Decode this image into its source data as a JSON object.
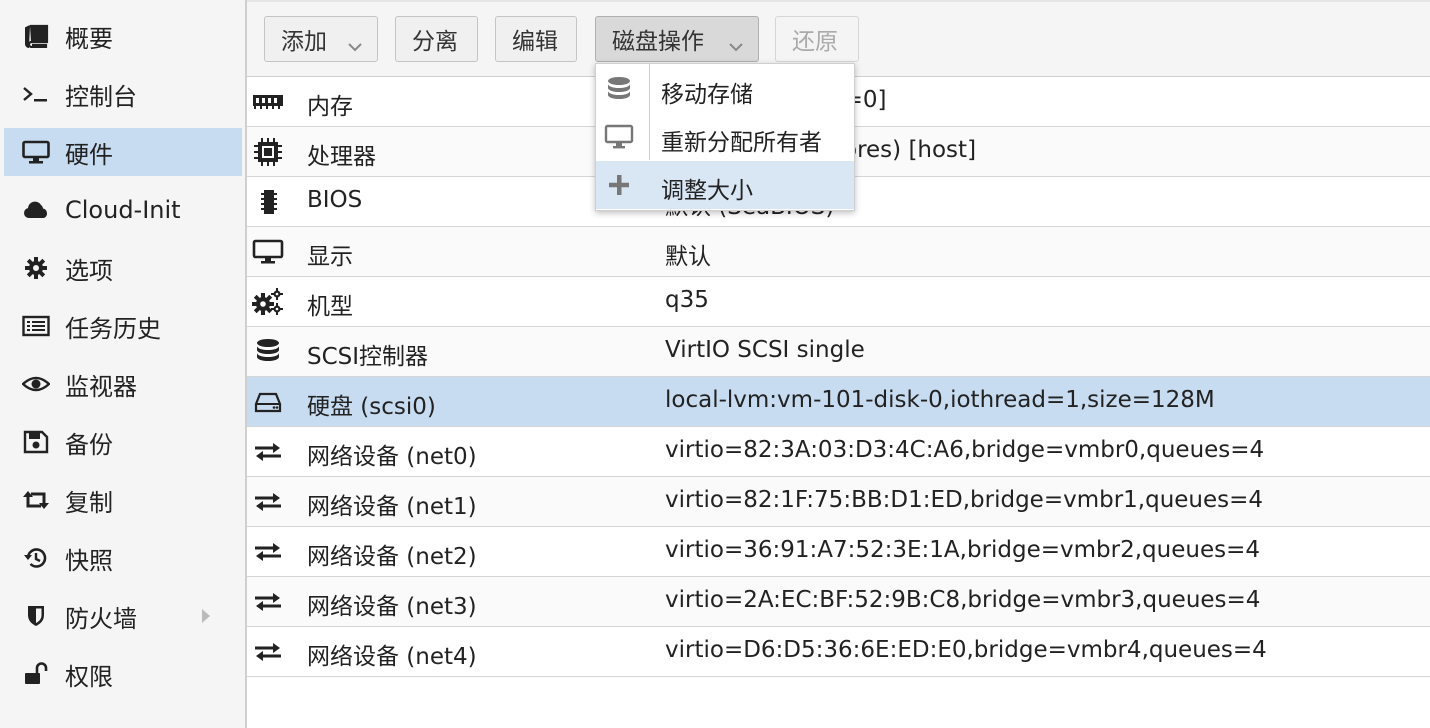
{
  "sidebar": {
    "items": [
      {
        "label": "概要",
        "icon": "book-icon",
        "active": false
      },
      {
        "label": "控制台",
        "icon": "terminal-icon",
        "active": false
      },
      {
        "label": "硬件",
        "icon": "monitor-icon",
        "active": true
      },
      {
        "label": "Cloud-Init",
        "icon": "cloud-icon",
        "active": false
      },
      {
        "label": "选项",
        "icon": "gear-icon",
        "active": false
      },
      {
        "label": "任务历史",
        "icon": "list-icon",
        "active": false
      },
      {
        "label": "监视器",
        "icon": "eye-icon",
        "active": false
      },
      {
        "label": "备份",
        "icon": "floppy-icon",
        "active": false
      },
      {
        "label": "复制",
        "icon": "retweet-icon",
        "active": false
      },
      {
        "label": "快照",
        "icon": "history-icon",
        "active": false
      },
      {
        "label": "防火墙",
        "icon": "shield-icon",
        "active": false,
        "expandable": true
      },
      {
        "label": "权限",
        "icon": "unlock-icon",
        "active": false
      }
    ]
  },
  "toolbar": {
    "add_label": "添加",
    "detach_label": "分离",
    "edit_label": "编辑",
    "disk_action_label": "磁盘操作",
    "revert_label": "还原"
  },
  "disk_menu": {
    "items": [
      {
        "label": "移动存储",
        "icon": "database-icon"
      },
      {
        "label": "重新分配所有者",
        "icon": "desktop-icon"
      },
      {
        "label": "调整大小",
        "icon": "plus-icon"
      }
    ]
  },
  "hardware": {
    "rows": [
      {
        "key": "内存",
        "value": "n=0]",
        "icon": "memory-icon"
      },
      {
        "key": "处理器",
        "value": "ores) [host]",
        "icon": "cpu-icon"
      },
      {
        "key": "BIOS",
        "value": "默认 (SeaBIOS)",
        "icon": "chip-icon"
      },
      {
        "key": "显示",
        "value": "默认",
        "icon": "display-icon"
      },
      {
        "key": "机型",
        "value": "q35",
        "icon": "cogs-icon"
      },
      {
        "key": "SCSI控制器",
        "value": "VirtIO SCSI single",
        "icon": "database-icon"
      },
      {
        "key": "硬盘 (scsi0)",
        "value": "local-lvm:vm-101-disk-0,iothread=1,size=128M",
        "icon": "hdd-icon",
        "selected": true
      },
      {
        "key": "网络设备 (net0)",
        "value": "virtio=82:3A:03:D3:4C:A6,bridge=vmbr0,queues=4",
        "icon": "exchange-icon"
      },
      {
        "key": "网络设备 (net1)",
        "value": "virtio=82:1F:75:BB:D1:ED,bridge=vmbr1,queues=4",
        "icon": "exchange-icon"
      },
      {
        "key": "网络设备 (net2)",
        "value": "virtio=36:91:A7:52:3E:1A,bridge=vmbr2,queues=4",
        "icon": "exchange-icon"
      },
      {
        "key": "网络设备 (net3)",
        "value": "virtio=2A:EC:BF:52:9B:C8,bridge=vmbr3,queues=4",
        "icon": "exchange-icon"
      },
      {
        "key": "网络设备 (net4)",
        "value": "virtio=D6:D5:36:6E:ED:E0,bridge=vmbr4,queues=4",
        "icon": "exchange-icon"
      }
    ]
  },
  "colors": {
    "selection": "#c7dcf1",
    "menu_hover": "#d9e6f3",
    "sidebar_bg": "#f5f5f5"
  }
}
